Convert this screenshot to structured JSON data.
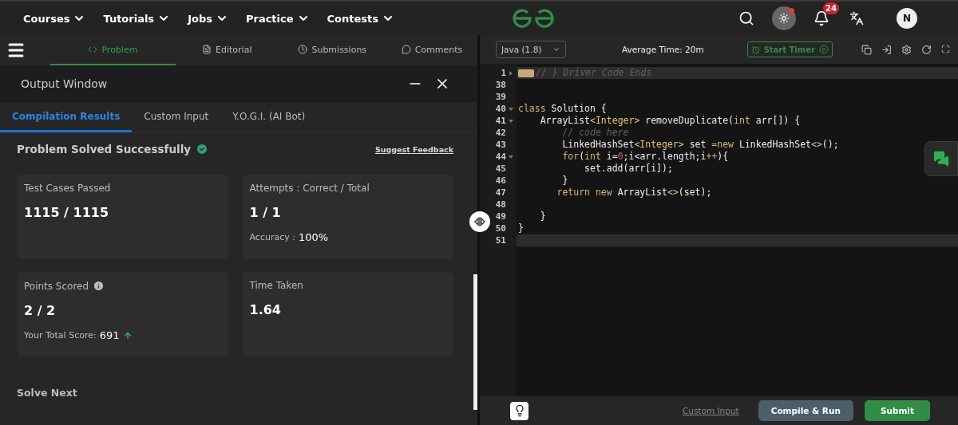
{
  "nav": {
    "menus": [
      {
        "label": "Courses"
      },
      {
        "label": "Tutorials"
      },
      {
        "label": "Jobs"
      },
      {
        "label": "Practice"
      },
      {
        "label": "Contests"
      }
    ],
    "notifications": "24",
    "avatar": "N"
  },
  "problem_tabs": [
    {
      "label": "Problem",
      "selected": true
    },
    {
      "label": "Editorial",
      "selected": false
    },
    {
      "label": "Submissions",
      "selected": false
    },
    {
      "label": "Comments",
      "selected": false
    }
  ],
  "output_window": {
    "title": "Output Window",
    "tabs": [
      {
        "label": "Compilation Results",
        "selected": true
      },
      {
        "label": "Custom Input",
        "selected": false
      },
      {
        "label": "Y.O.G.I. (AI Bot)",
        "selected": false
      }
    ],
    "status": "Problem Solved Successfully",
    "feedback_link": "Suggest Feedback",
    "cards": [
      {
        "title": "Test Cases Passed",
        "value": "1115 / 1115"
      },
      {
        "title": "Attempts : Correct / Total",
        "value": "1 / 1",
        "detail_label": "Accuracy :",
        "detail_value": "100%"
      },
      {
        "title": "Points Scored",
        "info": true,
        "value": "2 / 2",
        "detail_label": "Your Total Score:",
        "detail_value": "691",
        "trend_up": true
      },
      {
        "title": "Time Taken",
        "value": "1.64"
      }
    ],
    "solve_next": "Solve Next"
  },
  "editor": {
    "language": "Java (1.8)",
    "average_time": "Average Time: 20m",
    "timer_button": "Start Timer",
    "lines": [
      {
        "number": "1",
        "fold": true,
        "folded": true,
        "highlighted": true,
        "tokens": [
          {
            "kind": "comment",
            "text": "// } Driver Code Ends"
          }
        ]
      },
      {
        "number": "38"
      },
      {
        "number": "39"
      },
      {
        "number": "40",
        "fold": true,
        "tokens": [
          {
            "kind": "keyword",
            "text": "class"
          },
          {
            "kind": "plain",
            "text": " Solution {"
          }
        ]
      },
      {
        "number": "41",
        "fold": true,
        "tokens": [
          {
            "kind": "plain",
            "text": "    ArrayList"
          },
          {
            "kind": "type",
            "text": "<Integer>"
          },
          {
            "kind": "plain",
            "text": " removeDuplicate("
          },
          {
            "kind": "keyword",
            "text": "int"
          },
          {
            "kind": "plain",
            "text": " arr[]) {"
          }
        ]
      },
      {
        "number": "42",
        "tokens": [
          {
            "kind": "comment",
            "text": "        // code here"
          }
        ]
      },
      {
        "number": "43",
        "tokens": [
          {
            "kind": "plain",
            "text": "        LinkedHashSet"
          },
          {
            "kind": "type",
            "text": "<Integer>"
          },
          {
            "kind": "plain",
            "text": " set "
          },
          {
            "kind": "keyword",
            "text": "=new"
          },
          {
            "kind": "plain",
            "text": " LinkedHashSet"
          },
          {
            "kind": "type",
            "text": "<>"
          },
          {
            "kind": "plain",
            "text": "();"
          }
        ]
      },
      {
        "number": "44",
        "fold": true,
        "tokens": [
          {
            "kind": "keyword",
            "text": "        for"
          },
          {
            "kind": "plain",
            "text": "("
          },
          {
            "kind": "keyword",
            "text": "int"
          },
          {
            "kind": "plain",
            "text": " i="
          },
          {
            "kind": "number",
            "text": "0"
          },
          {
            "kind": "plain",
            "text": ";i<arr.length;i"
          },
          {
            "kind": "keyword",
            "text": "++"
          },
          {
            "kind": "plain",
            "text": "){"
          }
        ]
      },
      {
        "number": "45",
        "tokens": [
          {
            "kind": "plain",
            "text": "            set.add(arr[i]);"
          }
        ]
      },
      {
        "number": "46",
        "tokens": [
          {
            "kind": "plain",
            "text": "        }"
          }
        ]
      },
      {
        "number": "47",
        "tokens": [
          {
            "kind": "keyword",
            "text": "       return new"
          },
          {
            "kind": "plain",
            "text": " ArrayList"
          },
          {
            "kind": "type",
            "text": "<>"
          },
          {
            "kind": "plain",
            "text": "(set);"
          }
        ]
      },
      {
        "number": "48"
      },
      {
        "number": "49",
        "tokens": [
          {
            "kind": "plain",
            "text": "    }"
          }
        ]
      },
      {
        "number": "50",
        "tokens": [
          {
            "kind": "plain",
            "text": "}"
          }
        ]
      },
      {
        "number": "51",
        "highlighted": true
      }
    ],
    "custom_input_link": "Custom Input",
    "compile_button": "Compile & Run",
    "submit_button": "Submit"
  }
}
